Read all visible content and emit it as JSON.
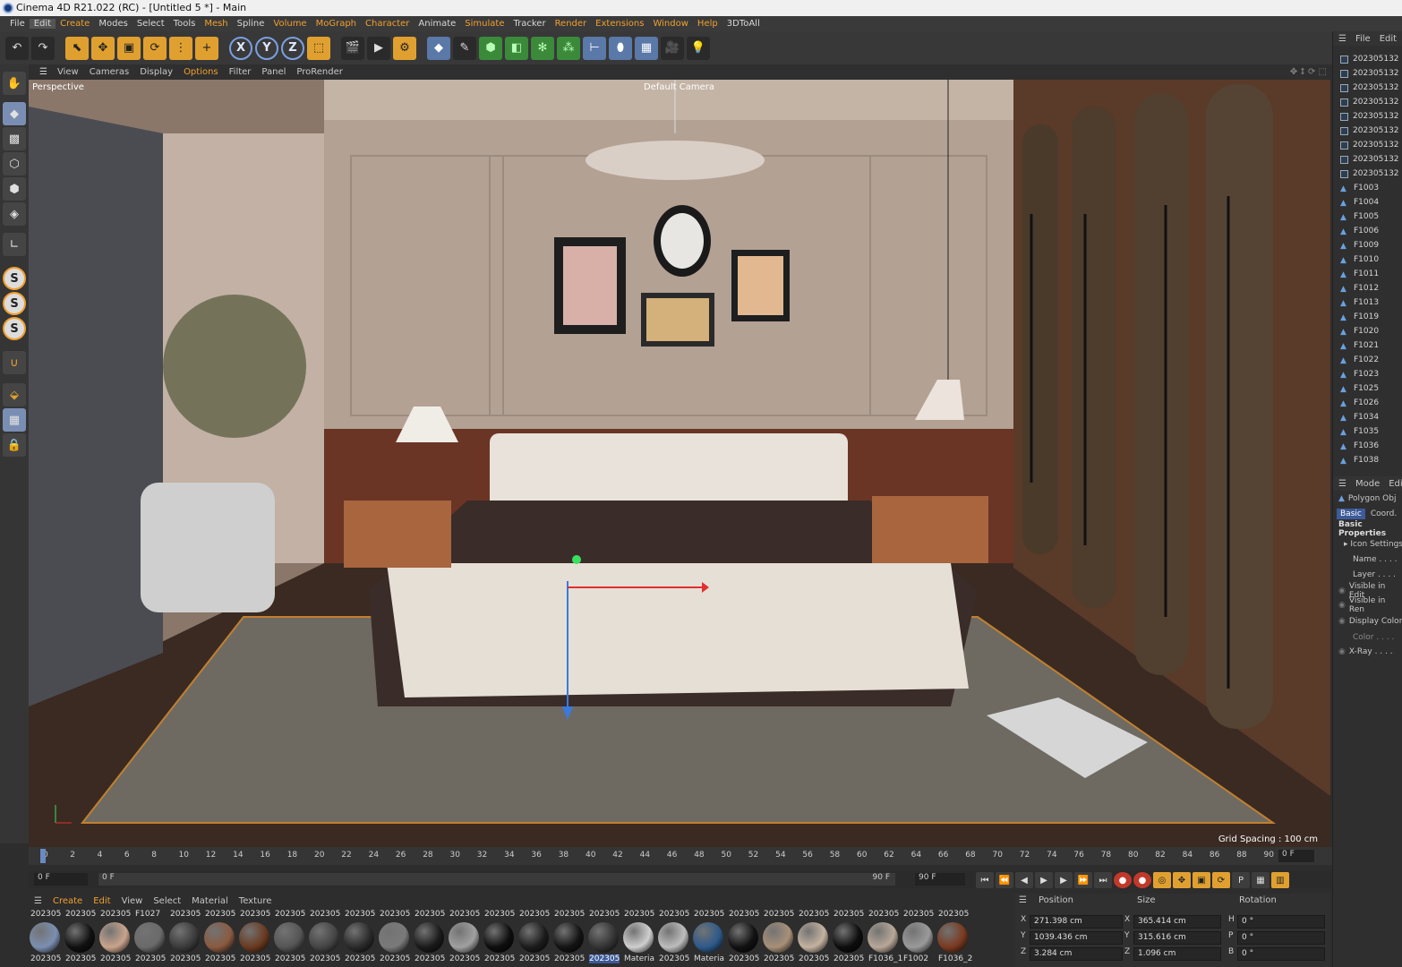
{
  "window": {
    "title": "Cinema 4D R21.022 (RC) - [Untitled 5 *] - Main"
  },
  "menubar": [
    "File",
    "Edit",
    "Create",
    "Modes",
    "Select",
    "Tools",
    "Mesh",
    "Spline",
    "Volume",
    "MoGraph",
    "Character",
    "Animate",
    "Simulate",
    "Tracker",
    "Render",
    "Extensions",
    "Window",
    "Help",
    "3DToAll"
  ],
  "viewport_menu": {
    "items": [
      "View",
      "Cameras",
      "Display",
      "Options",
      "Filter",
      "Panel",
      "ProRender"
    ]
  },
  "viewport": {
    "label": "Perspective",
    "camera": "Default Camera",
    "grid_spacing": "Grid Spacing : 100 cm"
  },
  "object_manager": {
    "menu": [
      "File",
      "Edit"
    ],
    "objects": [
      "202305132",
      "202305132",
      "202305132",
      "202305132",
      "202305132",
      "202305132",
      "202305132",
      "202305132",
      "202305132",
      "F1003",
      "F1004",
      "F1005",
      "F1006",
      "F1009",
      "F1010",
      "F1011",
      "F1012",
      "F1013",
      "F1019",
      "F1020",
      "F1021",
      "F1022",
      "F1023",
      "F1025",
      "F1026",
      "F1034",
      "F1035",
      "F1036",
      "F1038"
    ]
  },
  "attributes": {
    "menu": [
      "Mode",
      "Edit"
    ],
    "object_type": "Polygon Obj",
    "tabs": [
      "Basic",
      "Coord."
    ],
    "section": "Basic Properties",
    "icon_settings": "Icon Settings",
    "fields": [
      "Name . . . .",
      "Layer . . . ."
    ],
    "options": [
      "Visible in Edit",
      "Visible in Ren",
      "Display Color",
      "Color . . . .",
      "X-Ray . . . ."
    ]
  },
  "timeline": {
    "ticks": [
      "0",
      "2",
      "4",
      "6",
      "8",
      "10",
      "12",
      "14",
      "16",
      "18",
      "20",
      "22",
      "24",
      "26",
      "28",
      "30",
      "32",
      "34",
      "36",
      "38",
      "40",
      "42",
      "44",
      "46",
      "48",
      "50",
      "52",
      "54",
      "56",
      "58",
      "60",
      "62",
      "64",
      "66",
      "68",
      "70",
      "72",
      "74",
      "76",
      "78",
      "80",
      "82",
      "84",
      "86",
      "88",
      "90"
    ],
    "current_frame": "0 F",
    "end_frame": "0 F",
    "start_field": "0 F",
    "preview_start": "0 F",
    "preview_end": "90 F",
    "max_field": "90 F"
  },
  "material_manager": {
    "menu": [
      "Create",
      "Edit",
      "View",
      "Select",
      "Material",
      "Texture"
    ],
    "top_labels": [
      "202305",
      "202305",
      "202305",
      "F1027",
      "202305",
      "202305",
      "202305",
      "202305",
      "202305",
      "202305",
      "202305",
      "202305",
      "202305",
      "202305",
      "202305",
      "202305",
      "202305",
      "202305",
      "202305",
      "202305",
      "202305",
      "202305",
      "202305",
      "202305",
      "202305",
      "202305",
      "202305"
    ],
    "bottom_labels": [
      "202305",
      "202305",
      "202305",
      "202305",
      "202305",
      "202305",
      "202305",
      "202305",
      "202305",
      "202305",
      "202305",
      "202305",
      "202305",
      "202305",
      "202305",
      "202305",
      "202305",
      "Materia",
      "202305",
      "Materia",
      "202305",
      "202305",
      "202305",
      "202305",
      "F1036_1",
      "F1002",
      "F1036_2"
    ],
    "colors": [
      "#7b8fb0",
      "#101010",
      "#c9a48c",
      "#6a6a6a",
      "#3a3a3a",
      "#8a5a40",
      "#6a3a20",
      "#555555",
      "#444444",
      "#2a2a2a",
      "#7a7a7a",
      "#1a1a1a",
      "#a0a0a0",
      "#0e0e0e",
      "#1c1c1c",
      "#141414",
      "#333333",
      "#cfcfcf",
      "#bdbdbd",
      "#2d5a8a",
      "#111111",
      "#a89078",
      "#c4b2a0",
      "#0d0d0d",
      "#b8a898",
      "#9a9a9a",
      "#7a3a20"
    ]
  },
  "coordinates": {
    "headers": [
      "Position",
      "Size",
      "Rotation"
    ],
    "rows": [
      {
        "axis": "X",
        "position": "271.398 cm",
        "size": "365.414 cm",
        "rot_label": "H",
        "rotation": "0 °"
      },
      {
        "axis": "Y",
        "position": "1039.436 cm",
        "size": "315.616 cm",
        "rot_label": "P",
        "rotation": "0 °"
      },
      {
        "axis": "Z",
        "position": "3.284 cm",
        "size": "1.096 cm",
        "rot_label": "B",
        "rotation": "0 °"
      }
    ]
  },
  "colors": {
    "accent": "#f0a030",
    "selection": "#3d5a99",
    "panel": "#2f2f2f"
  }
}
